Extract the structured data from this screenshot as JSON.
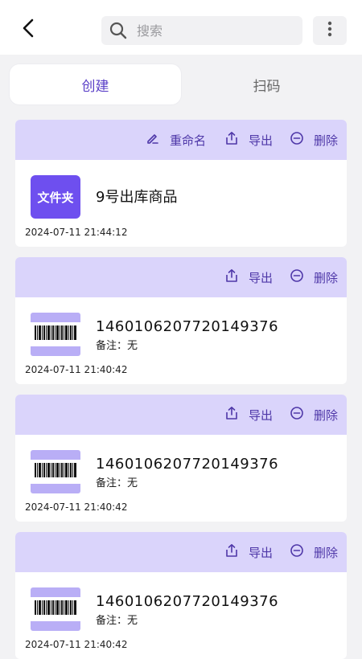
{
  "header": {
    "search_placeholder": "搜索"
  },
  "tabs": [
    {
      "label": "创建",
      "active": true
    },
    {
      "label": "扫码",
      "active": false
    }
  ],
  "actions": {
    "rename": "重命名",
    "export": "导出",
    "delete": "删除"
  },
  "colors": {
    "accent": "#5a3fc7",
    "card_header": "#dad4fb",
    "folder_thumb": "#6e4fef"
  },
  "items": [
    {
      "type": "folder",
      "thumb_label": "文件夹",
      "title": "9号出库商品",
      "time": "2024-07-11  21:44:12"
    },
    {
      "type": "barcode",
      "title": "1460106207720149376",
      "note": "备注：无",
      "time": "2024-07-11  21:40:42"
    },
    {
      "type": "barcode",
      "title": "1460106207720149376",
      "note": "备注：无",
      "time": "2024-07-11  21:40:42"
    },
    {
      "type": "barcode",
      "title": "1460106207720149376",
      "note": "备注：无",
      "time": "2024-07-11  21:40:42"
    }
  ]
}
